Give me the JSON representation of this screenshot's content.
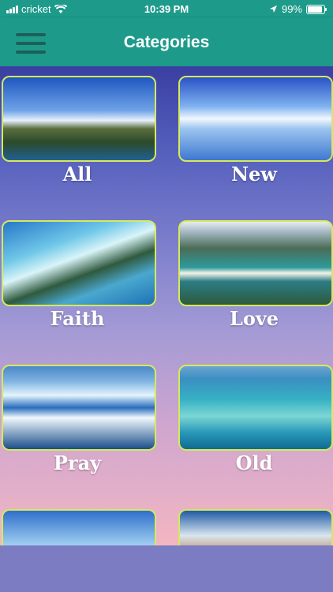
{
  "status": {
    "carrier": "cricket",
    "time": "10:39 PM",
    "battery_text": "99%",
    "battery_level": 0.99
  },
  "header": {
    "title": "Categories"
  },
  "categories": [
    {
      "label": "All"
    },
    {
      "label": "New"
    },
    {
      "label": "Faith"
    },
    {
      "label": "Love"
    },
    {
      "label": "Pray"
    },
    {
      "label": "Old"
    },
    {
      "label": ""
    },
    {
      "label": ""
    }
  ],
  "colors": {
    "header_bg": "#1e9a8a",
    "tile_border": "#d6ea5a"
  }
}
